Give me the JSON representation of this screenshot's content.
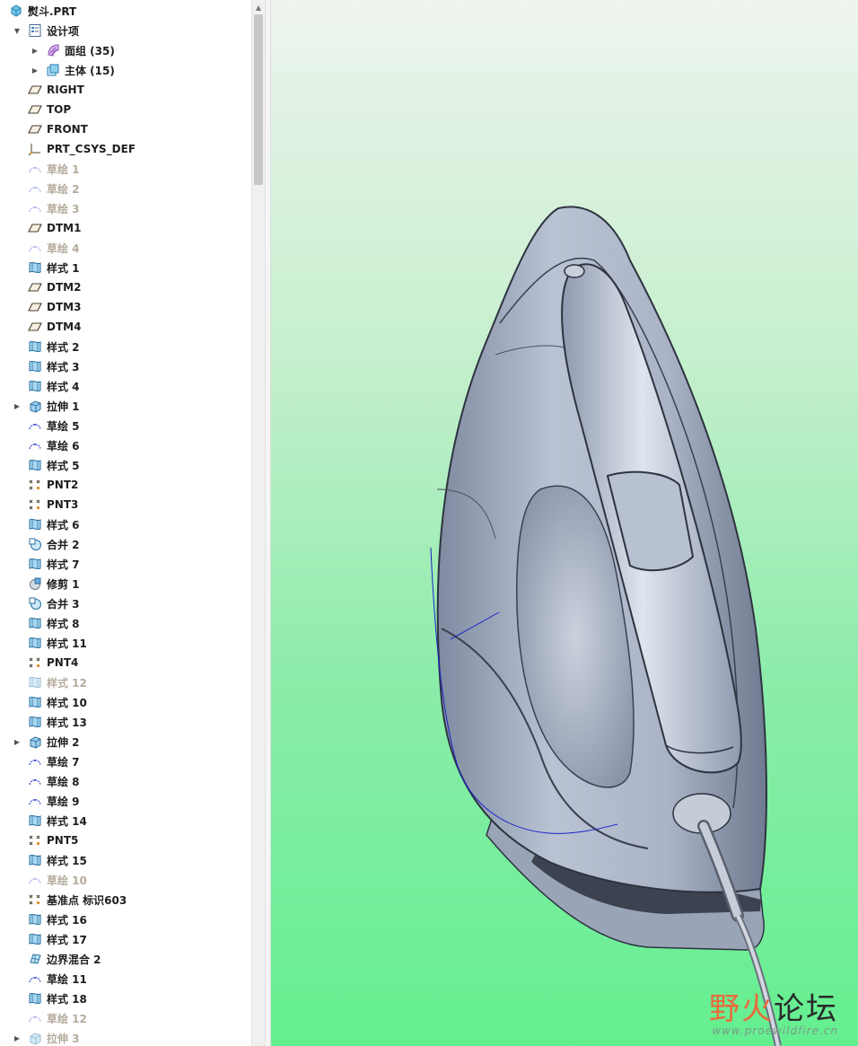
{
  "tree": {
    "rows": [
      {
        "label": "熨斗.PRT",
        "icon": "part-icon",
        "level": 0,
        "arrow": "",
        "dim": false
      },
      {
        "label": "设计项",
        "icon": "design-items-icon",
        "level": 1,
        "arrow": "down",
        "dim": false
      },
      {
        "label": "面组 (35)",
        "icon": "quilt-icon",
        "level": 2,
        "arrow": "right",
        "dim": false
      },
      {
        "label": "主体 (15)",
        "icon": "body-icon",
        "level": 2,
        "arrow": "right",
        "dim": false
      },
      {
        "label": "RIGHT",
        "icon": "datum-plane-icon",
        "level": 1,
        "arrow": "",
        "dim": false
      },
      {
        "label": "TOP",
        "icon": "datum-plane-icon",
        "level": 1,
        "arrow": "",
        "dim": false
      },
      {
        "label": "FRONT",
        "icon": "datum-plane-icon",
        "level": 1,
        "arrow": "",
        "dim": false
      },
      {
        "label": "PRT_CSYS_DEF",
        "icon": "csys-icon",
        "level": 1,
        "arrow": "",
        "dim": false
      },
      {
        "label": "草绘 1",
        "icon": "sketch-icon",
        "level": 1,
        "arrow": "",
        "dim": true
      },
      {
        "label": "草绘 2",
        "icon": "sketch-icon",
        "level": 1,
        "arrow": "",
        "dim": true
      },
      {
        "label": "草绘 3",
        "icon": "sketch-icon",
        "level": 1,
        "arrow": "",
        "dim": true
      },
      {
        "label": "DTM1",
        "icon": "datum-plane-icon",
        "level": 1,
        "arrow": "",
        "dim": false
      },
      {
        "label": "草绘 4",
        "icon": "sketch-icon",
        "level": 1,
        "arrow": "",
        "dim": true
      },
      {
        "label": "样式 1",
        "icon": "style-icon",
        "level": 1,
        "arrow": "",
        "dim": false
      },
      {
        "label": "DTM2",
        "icon": "datum-plane-icon",
        "level": 1,
        "arrow": "",
        "dim": false
      },
      {
        "label": "DTM3",
        "icon": "datum-plane-icon",
        "level": 1,
        "arrow": "",
        "dim": false
      },
      {
        "label": "DTM4",
        "icon": "datum-plane-icon",
        "level": 1,
        "arrow": "",
        "dim": false
      },
      {
        "label": "样式 2",
        "icon": "style-icon",
        "level": 1,
        "arrow": "",
        "dim": false
      },
      {
        "label": "样式 3",
        "icon": "style-icon",
        "level": 1,
        "arrow": "",
        "dim": false
      },
      {
        "label": "样式 4",
        "icon": "style-icon",
        "level": 1,
        "arrow": "",
        "dim": false
      },
      {
        "label": "拉伸 1",
        "icon": "extrude-icon",
        "level": 1,
        "arrow": "right",
        "dim": false
      },
      {
        "label": "草绘 5",
        "icon": "sketch-icon",
        "level": 1,
        "arrow": "",
        "dim": false
      },
      {
        "label": "草绘 6",
        "icon": "sketch-icon",
        "level": 1,
        "arrow": "",
        "dim": false
      },
      {
        "label": "样式 5",
        "icon": "style-icon",
        "level": 1,
        "arrow": "",
        "dim": false
      },
      {
        "label": "PNT2",
        "icon": "datum-point-icon",
        "level": 1,
        "arrow": "",
        "dim": false
      },
      {
        "label": "PNT3",
        "icon": "datum-point-icon",
        "level": 1,
        "arrow": "",
        "dim": false
      },
      {
        "label": "样式 6",
        "icon": "style-icon",
        "level": 1,
        "arrow": "",
        "dim": false
      },
      {
        "label": "合并 2",
        "icon": "merge-icon",
        "level": 1,
        "arrow": "",
        "dim": false
      },
      {
        "label": "样式 7",
        "icon": "style-icon",
        "level": 1,
        "arrow": "",
        "dim": false
      },
      {
        "label": "修剪 1",
        "icon": "trim-icon",
        "level": 1,
        "arrow": "",
        "dim": false
      },
      {
        "label": "合并 3",
        "icon": "merge-icon",
        "level": 1,
        "arrow": "",
        "dim": false
      },
      {
        "label": "样式 8",
        "icon": "style-icon",
        "level": 1,
        "arrow": "",
        "dim": false
      },
      {
        "label": "样式 11",
        "icon": "style-icon",
        "level": 1,
        "arrow": "",
        "dim": false
      },
      {
        "label": "PNT4",
        "icon": "datum-point-icon",
        "level": 1,
        "arrow": "",
        "dim": false
      },
      {
        "label": "样式 12",
        "icon": "style-icon",
        "level": 1,
        "arrow": "",
        "dim": true
      },
      {
        "label": "样式 10",
        "icon": "style-icon",
        "level": 1,
        "arrow": "",
        "dim": false
      },
      {
        "label": "样式 13",
        "icon": "style-icon",
        "level": 1,
        "arrow": "",
        "dim": false
      },
      {
        "label": "拉伸 2",
        "icon": "extrude-icon",
        "level": 1,
        "arrow": "right",
        "dim": false
      },
      {
        "label": "草绘 7",
        "icon": "sketch-icon",
        "level": 1,
        "arrow": "",
        "dim": false
      },
      {
        "label": "草绘 8",
        "icon": "sketch-icon",
        "level": 1,
        "arrow": "",
        "dim": false
      },
      {
        "label": "草绘 9",
        "icon": "sketch-icon",
        "level": 1,
        "arrow": "",
        "dim": false
      },
      {
        "label": "样式 14",
        "icon": "style-icon",
        "level": 1,
        "arrow": "",
        "dim": false
      },
      {
        "label": "PNT5",
        "icon": "datum-point-icon",
        "level": 1,
        "arrow": "",
        "dim": false
      },
      {
        "label": "样式 15",
        "icon": "style-icon",
        "level": 1,
        "arrow": "",
        "dim": false
      },
      {
        "label": "草绘 10",
        "icon": "sketch-icon",
        "level": 1,
        "arrow": "",
        "dim": true
      },
      {
        "label": "基准点 标识603",
        "icon": "datum-point-icon",
        "level": 1,
        "arrow": "",
        "dim": false
      },
      {
        "label": "样式 16",
        "icon": "style-icon",
        "level": 1,
        "arrow": "",
        "dim": false
      },
      {
        "label": "样式 17",
        "icon": "style-icon",
        "level": 1,
        "arrow": "",
        "dim": false
      },
      {
        "label": "边界混合 2",
        "icon": "boundary-blend-icon",
        "level": 1,
        "arrow": "",
        "dim": false
      },
      {
        "label": "草绘 11",
        "icon": "sketch-icon",
        "level": 1,
        "arrow": "",
        "dim": false
      },
      {
        "label": "样式 18",
        "icon": "style-icon",
        "level": 1,
        "arrow": "",
        "dim": false
      },
      {
        "label": "草绘 12",
        "icon": "sketch-icon",
        "level": 1,
        "arrow": "",
        "dim": true
      },
      {
        "label": "拉伸 3",
        "icon": "extrude-icon",
        "level": 1,
        "arrow": "right",
        "dim": true
      }
    ]
  },
  "viewport": {
    "watermark_title_a": "野火",
    "watermark_title_b": "论坛",
    "watermark_url": "www.proewildfire.cn"
  },
  "colors": {
    "sketch_curve": "#1a22c8",
    "body_shade": "#aeb8c8",
    "dim_text": "#b4ab9c"
  }
}
